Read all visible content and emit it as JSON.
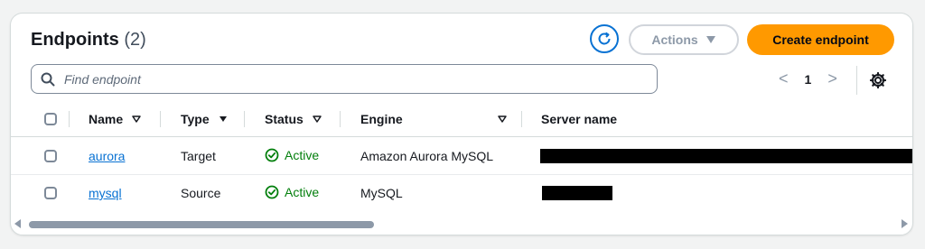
{
  "header": {
    "title": "Endpoints",
    "count": "(2)",
    "actions_label": "Actions",
    "create_label": "Create endpoint"
  },
  "search": {
    "placeholder": "Find endpoint"
  },
  "pagination": {
    "current_page": "1",
    "prev": "<",
    "next": ">"
  },
  "columns": {
    "name": "Name",
    "type": "Type",
    "status": "Status",
    "engine": "Engine",
    "server_name": "Server name"
  },
  "rows": [
    {
      "name": "aurora",
      "type": "Target",
      "status": "Active",
      "engine": "Amazon Aurora MySQL"
    },
    {
      "name": "mysql",
      "type": "Source",
      "status": "Active",
      "engine": "MySQL"
    }
  ],
  "colors": {
    "primary": "#0972d3",
    "accent_orange": "#ff9900",
    "success": "#037f0c"
  },
  "icons": [
    "refresh-icon",
    "caret-down-icon",
    "search-icon",
    "settings-gear-icon",
    "check-circle-icon",
    "sort-icon"
  ]
}
